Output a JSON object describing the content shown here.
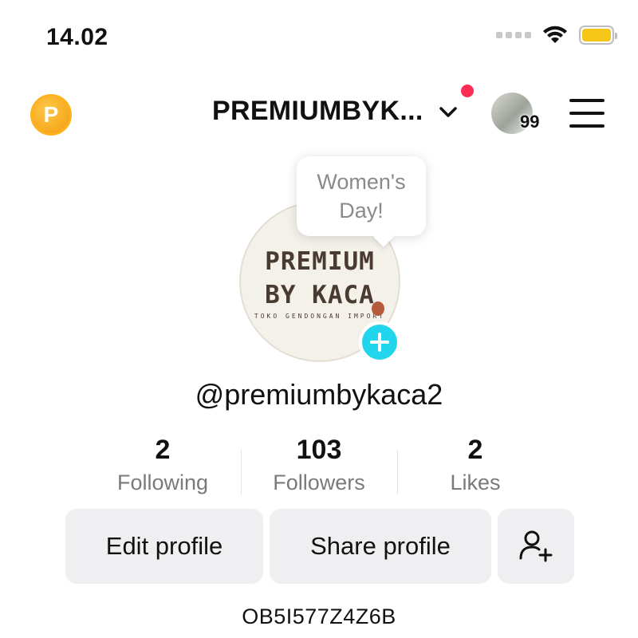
{
  "status_bar": {
    "time": "14.02",
    "battery_color": "#f5c518"
  },
  "header": {
    "coin_letter": "P",
    "username": "PREMIUMBYK...",
    "friends_count": "99",
    "notification_color": "#fe2c55"
  },
  "tooltip": {
    "line1": "Women's",
    "line2": "Day!"
  },
  "avatar": {
    "text_line1": "PREMIUM",
    "text_line2": "BY KACA",
    "text_line3": "TOKO GENDONGAN IMPORT",
    "add_button_color": "#20d5ec"
  },
  "profile": {
    "handle": "@premiumbykaca2",
    "bio": "OB5I577Z4Z6B"
  },
  "stats": [
    {
      "value": "2",
      "label": "Following"
    },
    {
      "value": "103",
      "label": "Followers"
    },
    {
      "value": "2",
      "label": "Likes"
    }
  ],
  "buttons": {
    "edit_profile": "Edit profile",
    "share_profile": "Share profile"
  },
  "icons": [
    "coin-icon",
    "chevron-down-icon",
    "menu-icon",
    "add-icon",
    "add-friend-icon",
    "wifi-icon",
    "battery-icon",
    "signal-icon"
  ]
}
